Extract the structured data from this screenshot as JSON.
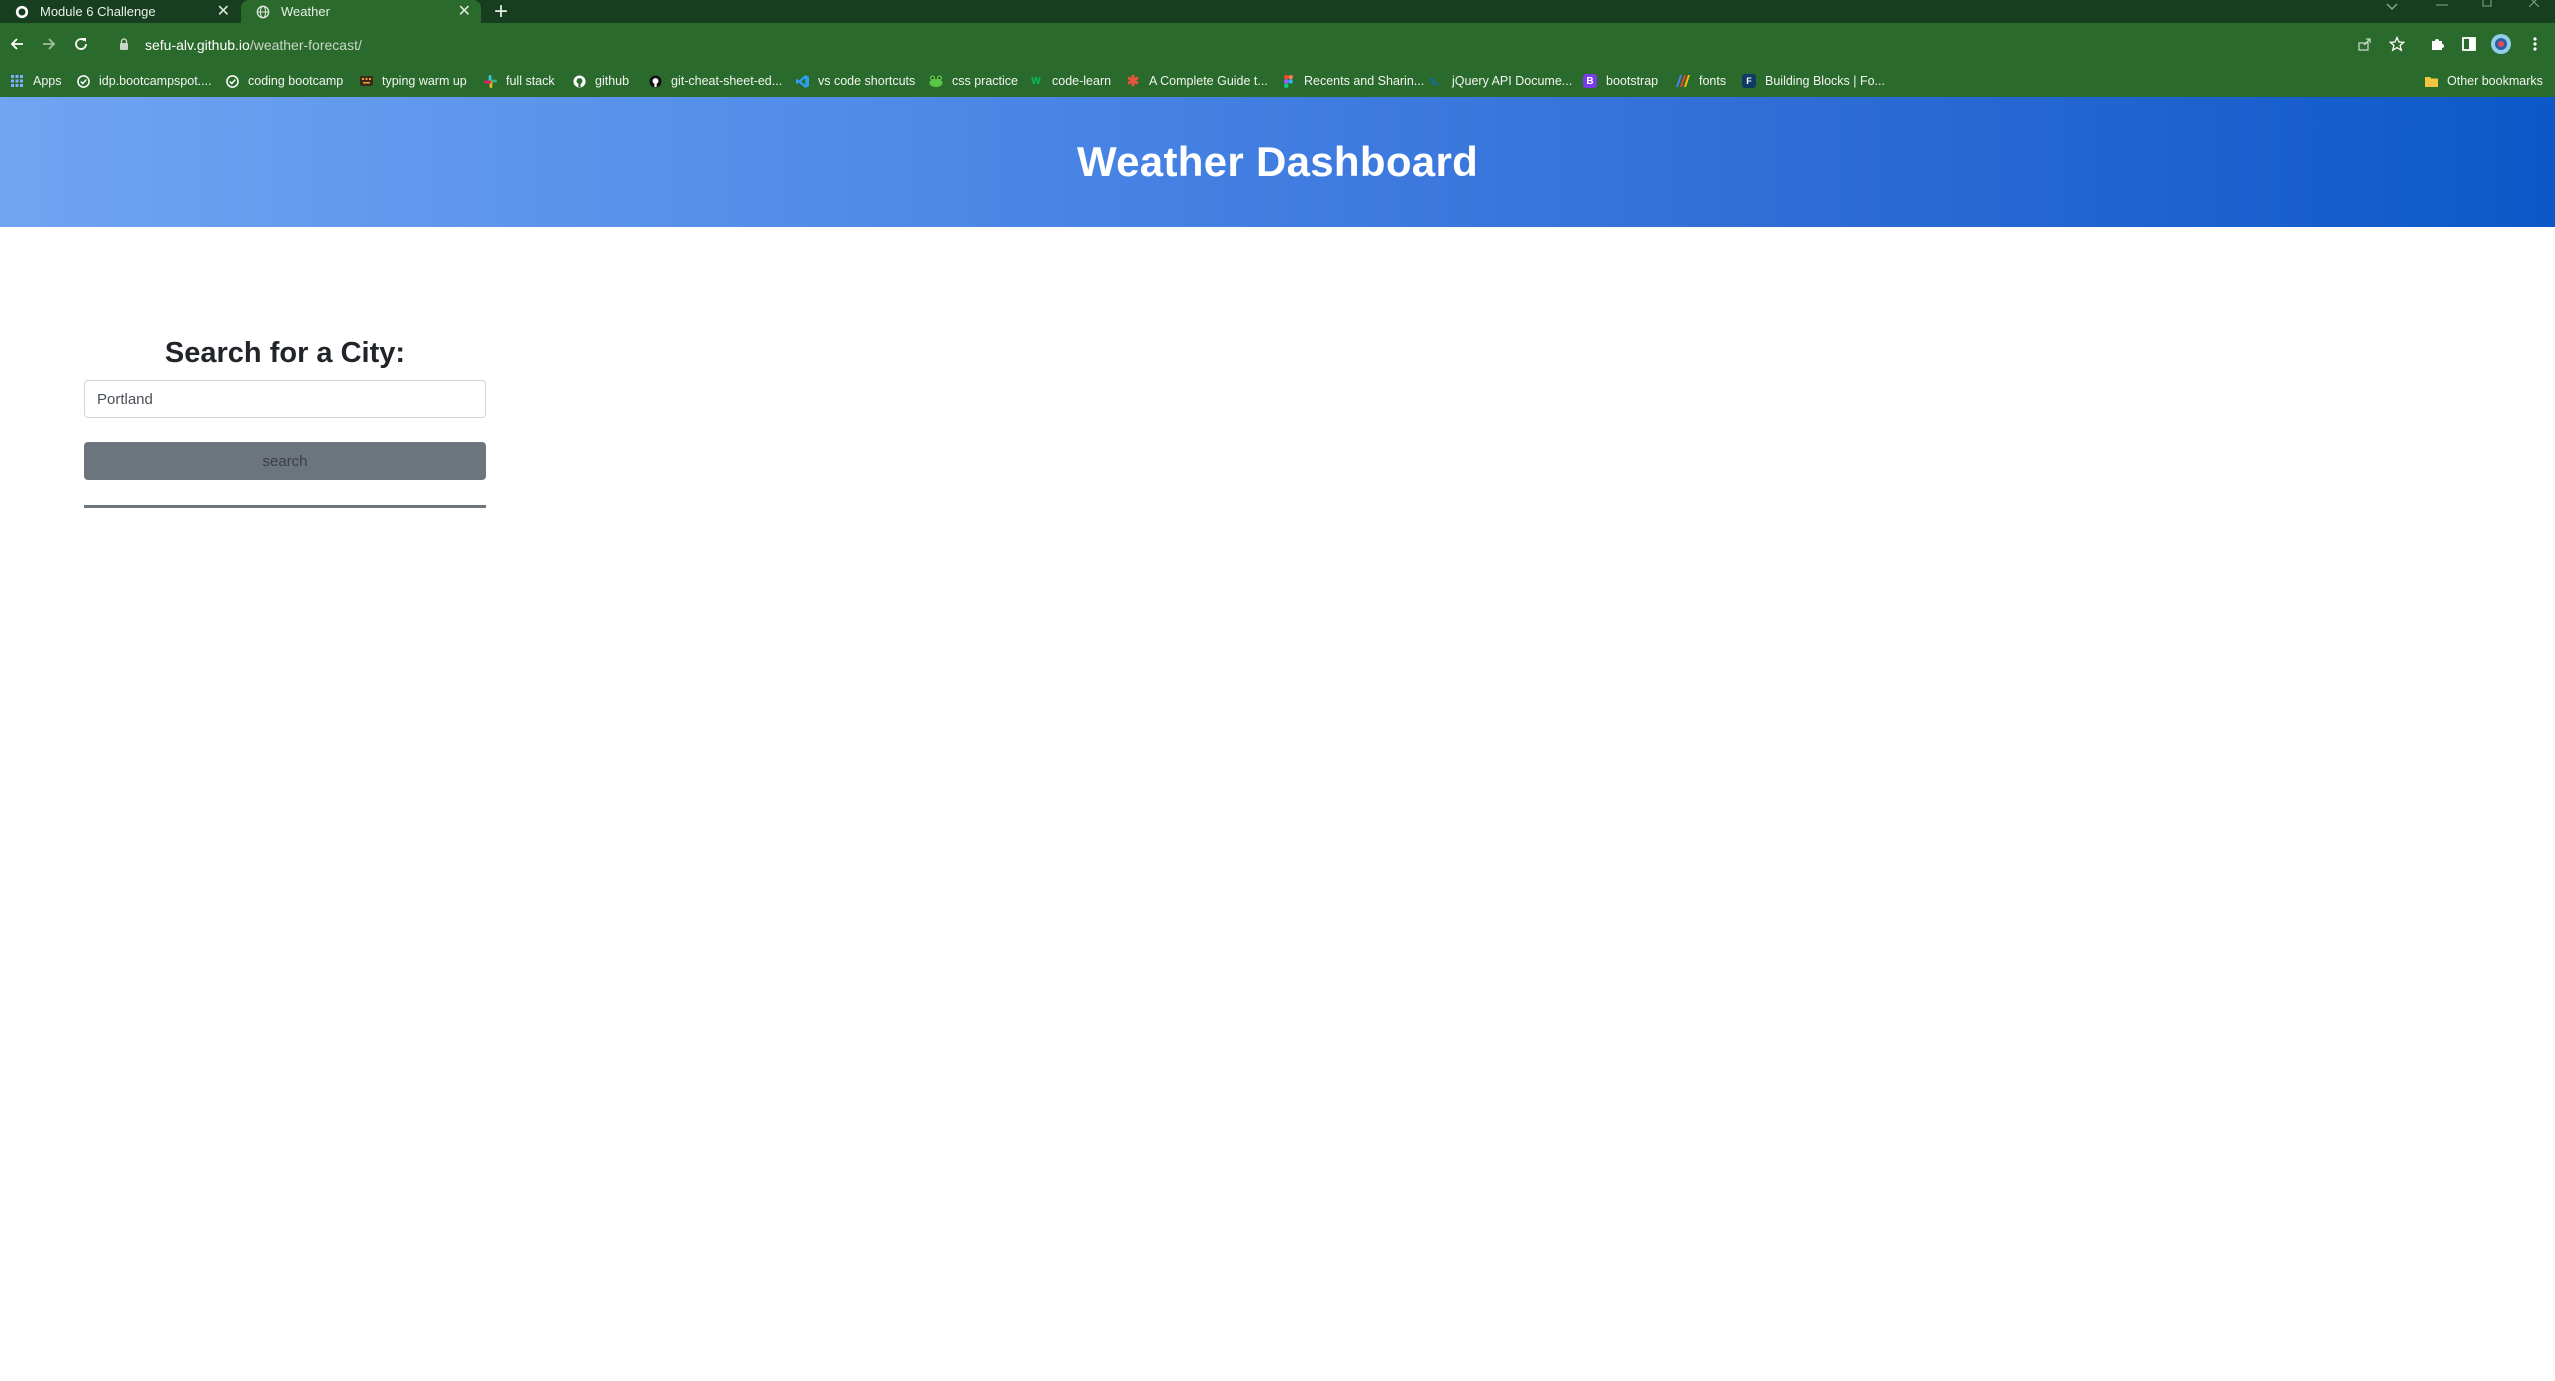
{
  "browser": {
    "tabs": [
      {
        "title": "Module 6 Challenge",
        "icon": "github-icon",
        "active": false
      },
      {
        "title": "Weather",
        "icon": "globe-icon",
        "active": true
      }
    ],
    "close_glyph": "✕",
    "new_tab_glyph": "+",
    "url_domain": "sefu-alv.github.io",
    "url_path": "/weather-forecast/",
    "bookmarks": [
      {
        "label": "Apps",
        "icon": "apps-grid-icon"
      },
      {
        "label": "idp.bootcampspot....",
        "icon": "circle-check-icon"
      },
      {
        "label": "coding bootcamp",
        "icon": "circle-check-icon"
      },
      {
        "label": "typing warm up",
        "icon": "keyboard-icon"
      },
      {
        "label": "full stack",
        "icon": "slack-icon"
      },
      {
        "label": "github",
        "icon": "github-icon"
      },
      {
        "label": "git-cheat-sheet-ed...",
        "icon": "github-icon"
      },
      {
        "label": "vs code shortcuts",
        "icon": "vscode-icon"
      },
      {
        "label": "css practice",
        "icon": "frog-icon"
      },
      {
        "label": "code-learn",
        "icon": "w-icon"
      },
      {
        "label": "A Complete Guide t...",
        "icon": "asterisk-icon"
      },
      {
        "label": "Recents and Sharin...",
        "icon": "figma-icon"
      },
      {
        "label": "jQuery API Docume...",
        "icon": "jquery-icon"
      },
      {
        "label": "bootstrap",
        "icon": "bootstrap-icon"
      },
      {
        "label": "fonts",
        "icon": "fonts-icon"
      },
      {
        "label": "Building Blocks | Fo...",
        "icon": "f-icon"
      }
    ],
    "other_bookmarks": "Other bookmarks"
  },
  "page": {
    "title": "Weather Dashboard",
    "search": {
      "heading": "Search for a City:",
      "input_value": "Portland",
      "button_label": "search"
    }
  },
  "colors": {
    "tab_strip": "#173e1f",
    "toolbar": "#2b6a2d",
    "hero_gradient_start": "#71a4f1",
    "hero_gradient_end": "#0c58c8",
    "button": "#6c757d"
  }
}
